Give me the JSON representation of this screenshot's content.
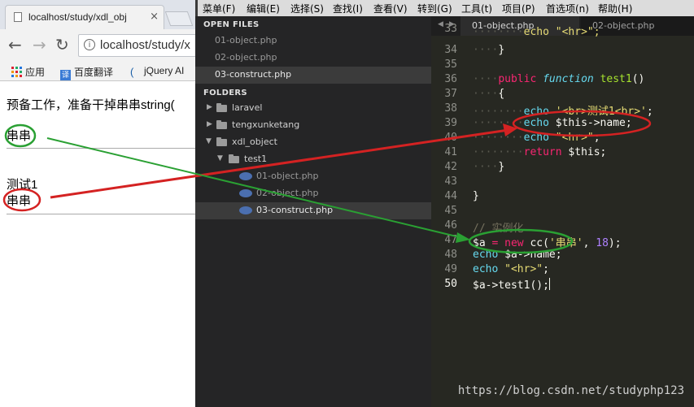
{
  "browser": {
    "tab_title": "localhost/study/xdl_obj",
    "url": "localhost/study/x",
    "bookmarks": [
      "应用",
      "百度翻译",
      "jQuery AI"
    ],
    "page_lines": [
      "预备工作，准备干掉串串string(",
      "串串",
      "测试1",
      "串串"
    ]
  },
  "editor": {
    "menu": [
      "菜单(F)",
      "编辑(E)",
      "选择(S)",
      "查找(I)",
      "查看(V)",
      "转到(G)",
      "工具(t)",
      "项目(P)",
      "首选项(n)",
      "帮助(H)"
    ],
    "sidebar": {
      "open_files_header": "OPEN FILES",
      "open_files": [
        "01-object.php",
        "02-object.php",
        "03-construct.php"
      ],
      "folders_header": "FOLDERS",
      "folders": [
        {
          "label": "laravel"
        },
        {
          "label": "tengxunketang"
        },
        {
          "label": "xdl_object"
        },
        {
          "label": "test1"
        },
        {
          "label": "01-object.php"
        },
        {
          "label": "02-object.php"
        },
        {
          "label": "03-construct.php"
        }
      ]
    },
    "tabs": [
      "01-object.php",
      "02-object.php"
    ],
    "line_numbers": [
      "33",
      "34",
      "35",
      "36",
      "37",
      "38",
      "39",
      "40",
      "41",
      "42",
      "43",
      "44",
      "45",
      "46",
      "47",
      "48",
      "49",
      "50"
    ],
    "code": {
      "l33_text": "echo \"<hr>\";",
      "l36_public": "public",
      "l36_function": "function",
      "l36_name": "test1",
      "l36_parens": "()",
      "l37": "{",
      "l38_echo": "echo",
      "l38_str": "'<br>测试1<br>'",
      "l38_semi": ";",
      "l39_echo": "echo",
      "l39_var": "$this->name;",
      "l40_echo": "echo",
      "l40_str": "\"<hr>\"",
      "l40_semi": ";",
      "l41_return": "return",
      "l41_var": "$this;",
      "l42": "}",
      "l44": "}",
      "l46": "// 实例化",
      "l47_var": "$a",
      "l47_eq": "=",
      "l47_new": "new",
      "l47_cls": "cc(",
      "l47_str": "'串串'",
      "l47_comma": ",",
      "l47_num": "18",
      "l47_end": ");",
      "l48_echo": "echo",
      "l48_var": "$a->name;",
      "l49_echo": "echo",
      "l49_str": "\"<hr>\"",
      "l49_semi": ";",
      "l50": "$a->test1();"
    }
  },
  "watermark": "https://blog.csdn.net/studyphp123",
  "colors": {
    "annotation_red": "#d42222",
    "annotation_green": "#2aa033",
    "editor_bg": "#272822",
    "sidebar_bg": "#252526"
  }
}
